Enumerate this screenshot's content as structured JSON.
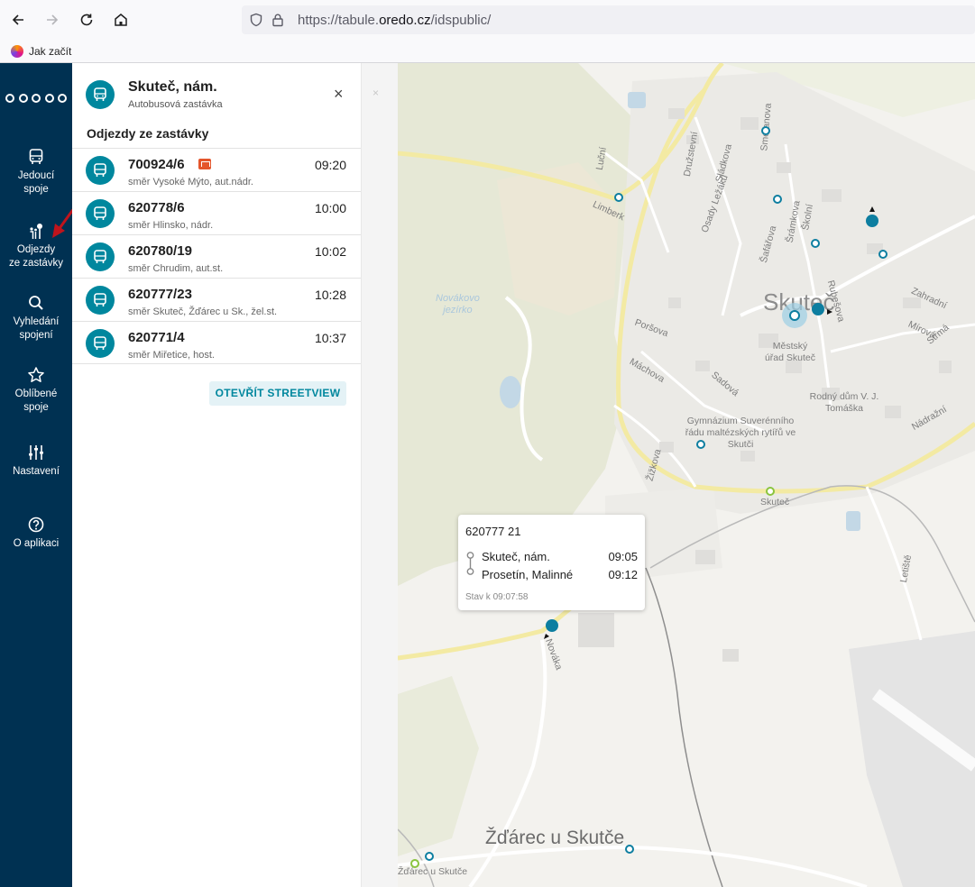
{
  "browser": {
    "url_prefix": "https://tabule.",
    "url_domain": "oredo.cz",
    "url_suffix": "/idspublic/",
    "bookmark": "Jak začít"
  },
  "rail": {
    "items": [
      {
        "label1": "Jedoucí",
        "label2": "spoje",
        "icon": "bus-icon"
      },
      {
        "label1": "Odjezdy",
        "label2": "ze zastávky",
        "icon": "stop-sign-icon"
      },
      {
        "label1": "Vyhledání",
        "label2": "spojení",
        "icon": "search-icon"
      },
      {
        "label1": "Oblíbené",
        "label2": "spoje",
        "icon": "star-icon"
      },
      {
        "label1": "Nastavení",
        "label2": "",
        "icon": "sliders-icon"
      },
      {
        "label1": "O aplikaci",
        "label2": "",
        "icon": "help-icon"
      }
    ]
  },
  "panel": {
    "stop_name": "Skuteč, nám.",
    "stop_type": "Autobusová zastávka",
    "section_title": "Odjezdy ze zastávky",
    "close_glyph": "×",
    "departures": [
      {
        "line": "700924/6",
        "direction": "směr Vysoké Mýto, aut.nádr.",
        "time": "09:20"
      },
      {
        "line": "620778/6",
        "direction": "směr Hlinsko, nádr.",
        "time": "10:00"
      },
      {
        "line": "620780/19",
        "direction": "směr Chrudim, aut.st.",
        "time": "10:02"
      },
      {
        "line": "620777/23",
        "direction": "směr Skuteč, Žďárec u Sk., žel.st.",
        "time": "10:28"
      },
      {
        "line": "620771/4",
        "direction": "směr Miřetice, host.",
        "time": "10:37"
      }
    ],
    "streetview_label": "OTEVŘÍT STREETVIEW"
  },
  "map": {
    "town": "Skuteč",
    "village": "Žďárec u Skutče",
    "lake": [
      "Novákovo",
      "jezírko"
    ],
    "labels": [
      "Luční",
      "Družstevní",
      "Sládkova",
      "Osady Ležáků",
      "Smetanova",
      "Šrámkova",
      "Šafářova",
      "Školní",
      "Rubešova",
      "Zahradní",
      "Mírová",
      "Strmá",
      "Poršova",
      "Máchova",
      "Sadová",
      "Žižkova",
      "Městský úřad Skuteč",
      "Rodný dům V. J. Tomáška",
      "Gymnázium Suverénního řádu maltézských rytířů ve Skutči",
      "Nádražní",
      "Skuteč",
      "Letiště",
      "Nováka",
      "Žďárec u Skutče",
      "Limberk"
    ]
  },
  "popup": {
    "title": "620777 21",
    "stops": [
      {
        "name": "Skuteč, nám.",
        "time": "09:05"
      },
      {
        "name": "Prosetín, Malinné",
        "time": "09:12"
      }
    ],
    "status": "Stav k 09:07:58"
  },
  "colors": {
    "rail": "#003152",
    "accent": "#00879e",
    "badge": "#e4552b"
  }
}
